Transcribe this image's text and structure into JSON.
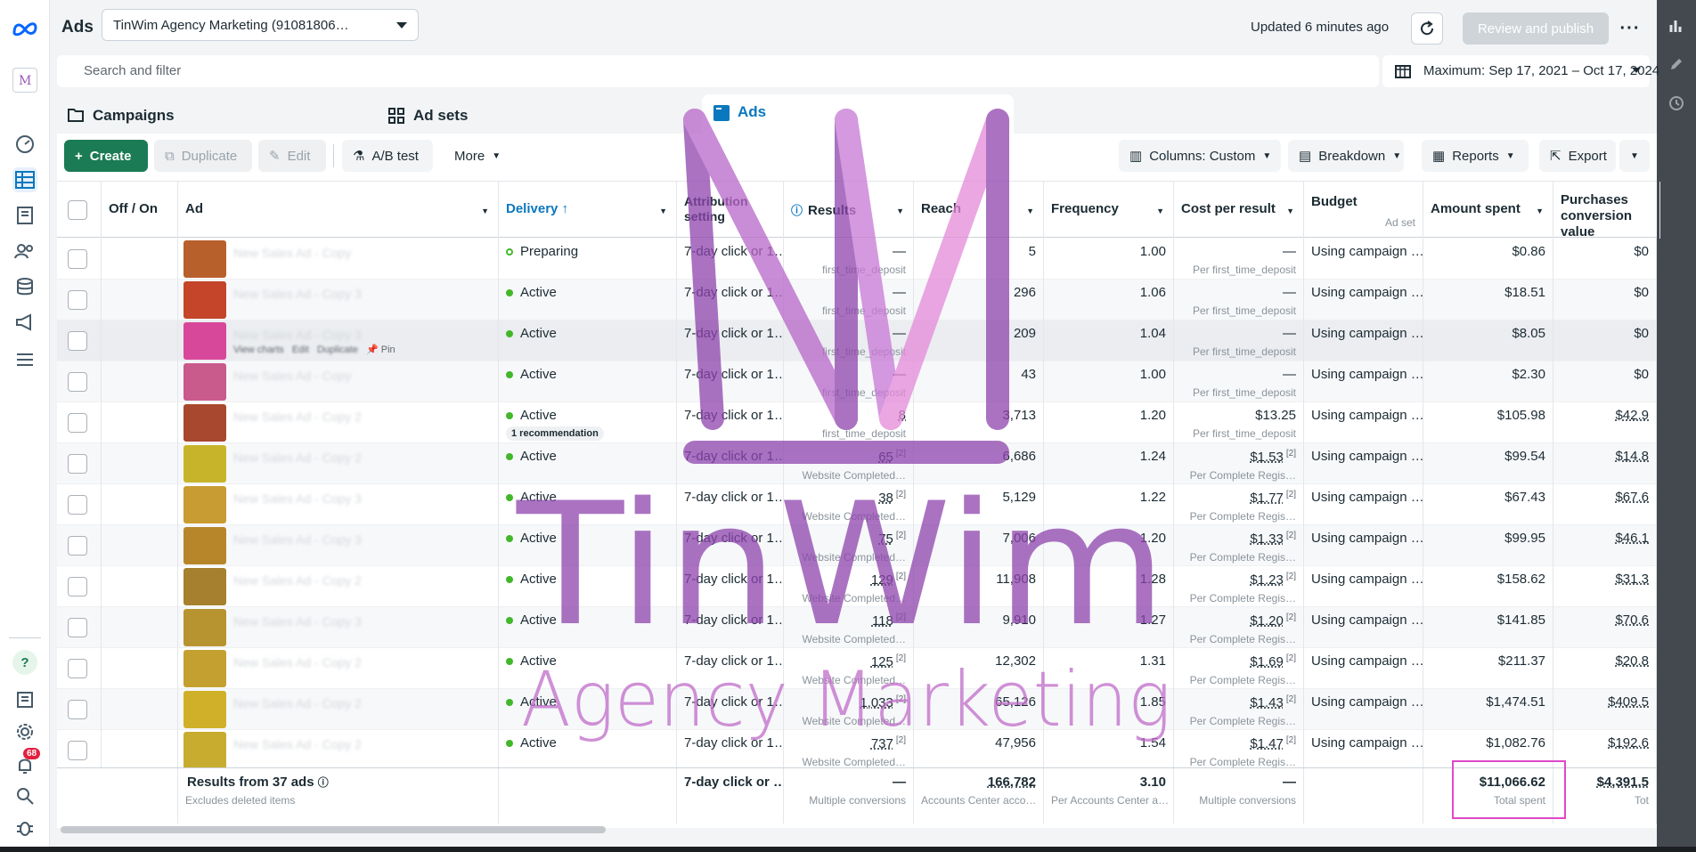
{
  "app": {
    "title": "Ads",
    "account": "TinWim Agency Marketing (91081806…",
    "updated": "Updated 6 minutes ago",
    "review_publish": "Review and publish",
    "more": "···"
  },
  "search": {
    "placeholder": "Search and filter"
  },
  "date_range": "Maximum: Sep 17, 2021 – Oct 17, 2024",
  "tabs": [
    {
      "label": "Campaigns"
    },
    {
      "label": "Ad sets"
    },
    {
      "label": "Ads"
    }
  ],
  "toolbar": {
    "create": "Create",
    "duplicate": "Duplicate",
    "edit": "Edit",
    "ab_test": "A/B test",
    "more": "More",
    "columns": "Columns: Custom",
    "breakdown": "Breakdown",
    "reports": "Reports",
    "export": "Export"
  },
  "columns": {
    "off_on": "Off / On",
    "ad": "Ad",
    "delivery": "Delivery ↑",
    "attribution": "Attribution setting",
    "results": "Results",
    "reach": "Reach",
    "frequency": "Frequency",
    "cost_per_result": "Cost per result",
    "budget": "Budget",
    "budget_sub": "Ad set",
    "amount_spent": "Amount spent",
    "purchases": "Purchases conversion value"
  },
  "rows": [
    {
      "name": "New Sales Ad - Copy",
      "delivery": "Preparing",
      "attribution": "7-day click or 1…",
      "results": "—",
      "results_sub": "first_time_deposit",
      "reach": "5",
      "frequency": "1.00",
      "cpr": "—",
      "cpr_sub": "Per first_time_deposit",
      "budget": "Using campaign …",
      "spent": "$0.86",
      "purch": "$0"
    },
    {
      "name": "New Sales Ad - Copy 3",
      "delivery": "Active",
      "attribution": "7-day click or 1…",
      "results": "—",
      "results_sub": "first_time_deposit",
      "reach": "296",
      "frequency": "1.06",
      "cpr": "—",
      "cpr_sub": "Per first_time_deposit",
      "budget": "Using campaign …",
      "spent": "$18.51",
      "purch": "$0"
    },
    {
      "name": "New Sales Ad - Copy 3",
      "delivery": "Active",
      "attribution": "7-day click or 1…",
      "results": "—",
      "results_sub": "first_time_deposit",
      "reach": "209",
      "frequency": "1.04",
      "cpr": "—",
      "cpr_sub": "Per first_time_deposit",
      "budget": "Using campaign …",
      "spent": "$8.05",
      "purch": "$0"
    },
    {
      "name": "New Sales Ad - Copy",
      "delivery": "Active",
      "attribution": "7-day click or 1…",
      "results": "—",
      "results_sub": "first_time_deposit",
      "reach": "43",
      "frequency": "1.00",
      "cpr": "—",
      "cpr_sub": "Per first_time_deposit",
      "budget": "Using campaign …",
      "spent": "$2.30",
      "purch": "$0"
    },
    {
      "name": "New Sales Ad - Copy 2",
      "delivery": "Active",
      "attribution": "7-day click or 1…",
      "results": "8",
      "results_sub": "first_time_deposit",
      "reach": "3,713",
      "frequency": "1.20",
      "cpr": "$13.25",
      "cpr_sub": "Per first_time_deposit",
      "budget": "Using campaign …",
      "spent": "$105.98",
      "purch": "$42.9"
    },
    {
      "name": "New Sales Ad - Copy 2",
      "delivery": "Active",
      "attribution": "7-day click or 1…",
      "results": "65",
      "results_sub": "Website Completed…",
      "reach": "6,686",
      "frequency": "1.24",
      "cpr": "$1.53",
      "cpr_sub": "Per Complete Regis…",
      "budget": "Using campaign …",
      "spent": "$99.54",
      "purch": "$14.8"
    },
    {
      "name": "New Sales Ad - Copy 3",
      "delivery": "Active",
      "attribution": "7-day click or 1…",
      "results": "38",
      "results_sub": "Website Completed…",
      "reach": "5,129",
      "frequency": "1.22",
      "cpr": "$1.77",
      "cpr_sub": "Per Complete Regis…",
      "budget": "Using campaign …",
      "spent": "$67.43",
      "purch": "$67.6"
    },
    {
      "name": "New Sales Ad - Copy 3",
      "delivery": "Active",
      "attribution": "7-day click or 1…",
      "results": "75",
      "results_sub": "Website Completed…",
      "reach": "7,006",
      "frequency": "1.20",
      "cpr": "$1.33",
      "cpr_sub": "Per Complete Regis…",
      "budget": "Using campaign …",
      "spent": "$99.95",
      "purch": "$46.1"
    },
    {
      "name": "New Sales Ad - Copy 2",
      "delivery": "Active",
      "attribution": "7-day click or 1…",
      "results": "129",
      "results_sub": "Website Completed…",
      "reach": "11,908",
      "frequency": "1.28",
      "cpr": "$1.23",
      "cpr_sub": "Per Complete Regis…",
      "budget": "Using campaign …",
      "spent": "$158.62",
      "purch": "$31.3"
    },
    {
      "name": "New Sales Ad - Copy 3",
      "delivery": "Active",
      "attribution": "7-day click or 1…",
      "results": "118",
      "results_sub": "Website Completed…",
      "reach": "9,910",
      "frequency": "1.27",
      "cpr": "$1.20",
      "cpr_sub": "Per Complete Regis…",
      "budget": "Using campaign …",
      "spent": "$141.85",
      "purch": "$70.6"
    },
    {
      "name": "New Sales Ad - Copy 2",
      "delivery": "Active",
      "attribution": "7-day click or 1…",
      "results": "125",
      "results_sub": "Website Completed…",
      "reach": "12,302",
      "frequency": "1.31",
      "cpr": "$1.69",
      "cpr_sub": "Per Complete Regis…",
      "budget": "Using campaign …",
      "spent": "$211.37",
      "purch": "$20.8"
    },
    {
      "name": "New Sales Ad - Copy 2",
      "delivery": "Active",
      "attribution": "7-day click or 1…",
      "results": "1,033",
      "results_sub": "Website Completed…",
      "reach": "65,126",
      "frequency": "1.85",
      "cpr": "$1.43",
      "cpr_sub": "Per Complete Regis…",
      "budget": "Using campaign …",
      "spent": "$1,474.51",
      "purch": "$409.5"
    },
    {
      "name": "New Sales Ad - Copy 2",
      "delivery": "Active",
      "attribution": "7-day click or 1…",
      "results": "737",
      "results_sub": "Website Completed…",
      "reach": "47,956",
      "frequency": "1.54",
      "cpr": "$1.47",
      "cpr_sub": "Per Complete Regis…",
      "budget": "Using campaign …",
      "spent": "$1,082.76",
      "purch": "$192.6"
    }
  ],
  "row_actions": {
    "view_charts": "View charts",
    "edit": "Edit",
    "duplicate": "Duplicate",
    "pin": "Pin"
  },
  "recommendation": "1 recommendation",
  "totals": {
    "label": "Results from 37 ads",
    "sub": "Excludes deleted items",
    "attribution": "7-day click or …",
    "results": "—",
    "results_sub": "Multiple conversions",
    "reach": "166,782",
    "reach_sub": "Accounts Center acco…",
    "frequency": "3.10",
    "frequency_sub": "Per Accounts Center a…",
    "cpr": "—",
    "cpr_sub": "Multiple conversions",
    "spent": "$11,066.62",
    "spent_sub": "Total spent",
    "purch": "$4,391.5",
    "purch_sub": "Tot"
  },
  "notifications_count": "68",
  "watermark": {
    "line1": "TinWim",
    "line2": "Agency Marketing"
  },
  "colors": {
    "accent": "#0a78be",
    "create_green": "#1a7b55",
    "active_dot": "#42b72a",
    "highlight_box": "#e048c8"
  }
}
